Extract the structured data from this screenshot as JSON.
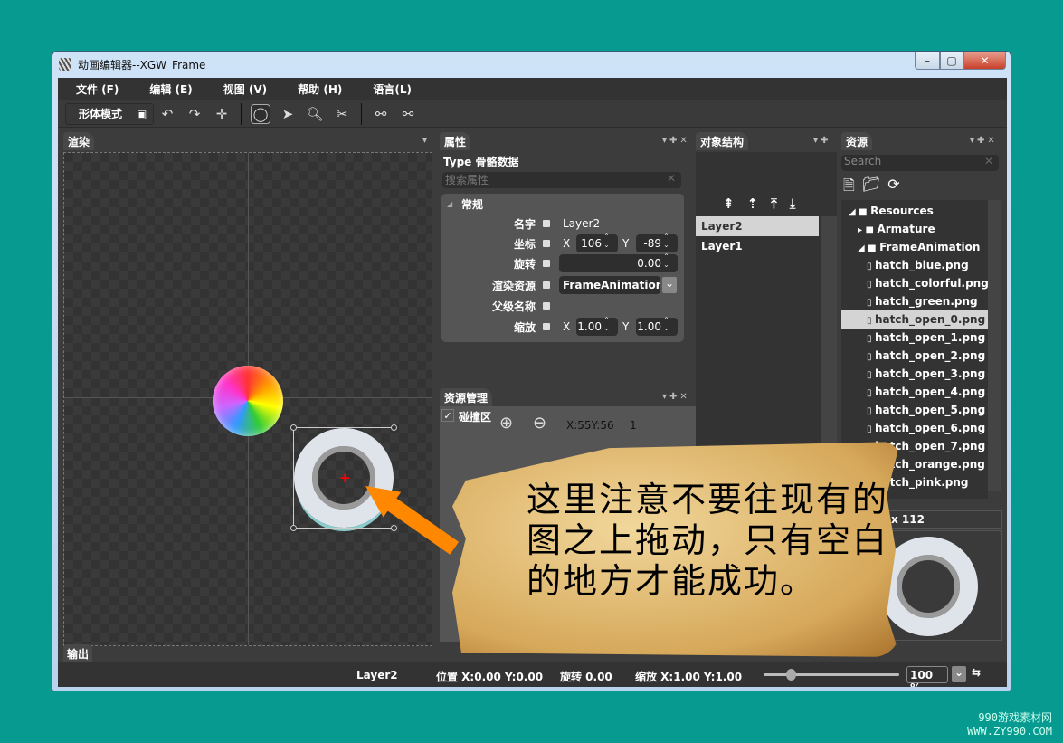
{
  "window": {
    "title": "动画编辑器--XGW_Frame",
    "min": "–",
    "max": "▢",
    "close": "✕"
  },
  "menu": [
    "文件 (F)",
    "编辑 (E)",
    "视图 (V)",
    "帮助 (H)",
    "语言(L)"
  ],
  "toolbar": {
    "mode_label": "形体模式",
    "icons": [
      "skeleton-icon",
      "rotate-ccw-icon",
      "rotate-cw-icon",
      "center-icon",
      "circle-select-icon",
      "pointer-move-icon",
      "zoom-icon",
      "bone-tool-icon",
      "bone-view-icon",
      "bone-link-icon"
    ]
  },
  "render_panel": {
    "title": "渲染"
  },
  "properties": {
    "title": "属性",
    "type_line": "Type 骨骼数据",
    "search_placeholder": "搜索属性",
    "group": "常规",
    "name_label": "名字",
    "name_value": "Layer2",
    "pos_label": "坐标",
    "pos_x": "106",
    "pos_y": "-89",
    "rot_label": "旋转",
    "rot_value": "0.00",
    "src_label": "渲染资源",
    "src_value": "FrameAnimation/h",
    "parent_label": "父级名称",
    "scale_label": "缩放",
    "scale_x": "1.00",
    "scale_y": "1.00",
    "x": "X",
    "y": "Y"
  },
  "objects": {
    "title": "对象结构",
    "items": [
      "Layer2",
      "Layer1"
    ],
    "selected": "Layer2"
  },
  "resources": {
    "title": "资源",
    "search_placeholder": "Search",
    "tree": [
      {
        "label": "Resources",
        "level": 0,
        "type": "folder",
        "expanded": true
      },
      {
        "label": "Armature",
        "level": 1,
        "type": "folder",
        "expanded": false
      },
      {
        "label": "FrameAnimation",
        "level": 1,
        "type": "folder",
        "expanded": true
      },
      {
        "label": "hatch_blue.png",
        "level": 2,
        "type": "file"
      },
      {
        "label": "hatch_colorful.png",
        "level": 2,
        "type": "file"
      },
      {
        "label": "hatch_green.png",
        "level": 2,
        "type": "file"
      },
      {
        "label": "hatch_open_0.png",
        "level": 2,
        "type": "file",
        "selected": true
      },
      {
        "label": "hatch_open_1.png",
        "level": 2,
        "type": "file"
      },
      {
        "label": "hatch_open_2.png",
        "level": 2,
        "type": "file"
      },
      {
        "label": "hatch_open_3.png",
        "level": 2,
        "type": "file"
      },
      {
        "label": "hatch_open_4.png",
        "level": 2,
        "type": "file"
      },
      {
        "label": "hatch_open_5.png",
        "level": 2,
        "type": "file"
      },
      {
        "label": "hatch_open_6.png",
        "level": 2,
        "type": "file"
      },
      {
        "label": "hatch_open_7.png",
        "level": 2,
        "type": "file"
      },
      {
        "label": "hatch_orange.png",
        "level": 2,
        "type": "file"
      },
      {
        "label": "hatch_pink.png",
        "level": 2,
        "type": "file"
      }
    ],
    "preview_size": "x  112"
  },
  "asset_manager": {
    "title": "资源管理",
    "collision_label": "碰撞区",
    "collision_checked": true,
    "coords": "X:55Y:56",
    "count": "1"
  },
  "output_tab": "输出",
  "status": {
    "layer": "Layer2",
    "position": "位置 X:0.00   Y:0.00",
    "rotation": "旋转 0.00",
    "scale": "缩放 X:1.00   Y:1.00",
    "zoom": "100 %",
    "zoom_slider": 0.2
  },
  "annotation": {
    "text": "这里注意不要往现有的图之上拖动，只有空白的地方才能成功。"
  },
  "watermark": {
    "line1": "990游戏素材网",
    "line2": "WWW.ZY990.COM"
  }
}
